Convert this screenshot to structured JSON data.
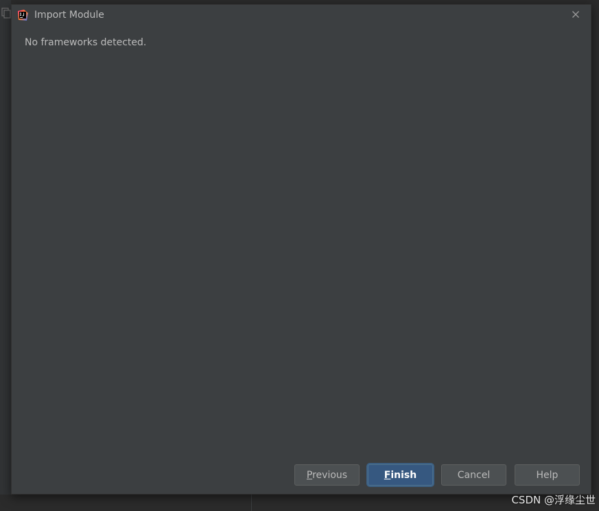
{
  "dialog": {
    "title": "Import Module",
    "message": "No frameworks detected."
  },
  "buttons": {
    "previous": {
      "mnemonic": "P",
      "rest": "revious"
    },
    "finish": {
      "mnemonic": "F",
      "rest": "inish"
    },
    "cancel": "Cancel",
    "help": "Help"
  },
  "watermark": "CSDN @浮缘尘世",
  "colors": {
    "dialog_bg": "#3c3f41",
    "text": "#bbbbbb",
    "primary_button": "#365880",
    "button": "#4c5052"
  },
  "icons": {
    "app": "intellij-idea-icon",
    "close": "close-icon"
  }
}
